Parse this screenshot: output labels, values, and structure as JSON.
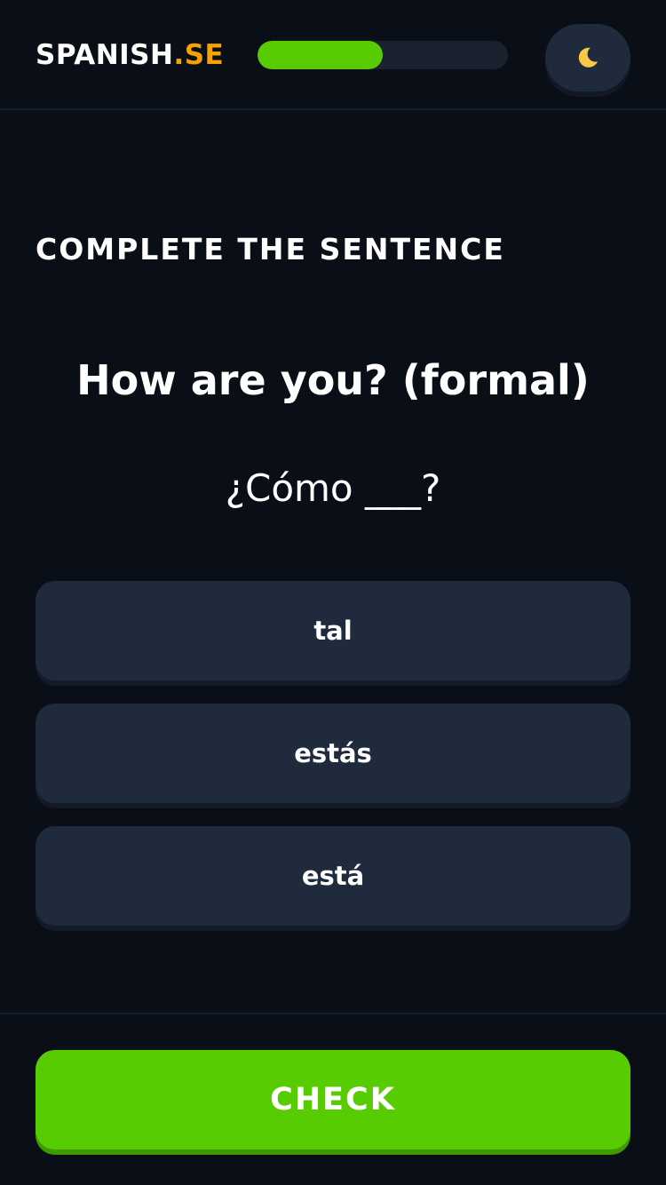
{
  "header": {
    "logo_main": "SPANISH",
    "logo_suffix": ".SE",
    "progress": 0.5,
    "theme_toggle_icon": "moon-icon"
  },
  "exercise": {
    "instruction": "COMPLETE THE SENTENCE",
    "prompt": "How are you? (formal)",
    "sentence": "¿Cómo ___?",
    "options": [
      {
        "label": "tal"
      },
      {
        "label": "estás"
      },
      {
        "label": "está"
      }
    ]
  },
  "footer": {
    "check_label": "CHECK"
  },
  "colors": {
    "background": "#090e17",
    "accent_green": "#58cc02",
    "logo_accent": "#f5a300",
    "card": "#1f2a3d",
    "moon": "#f7c948"
  }
}
